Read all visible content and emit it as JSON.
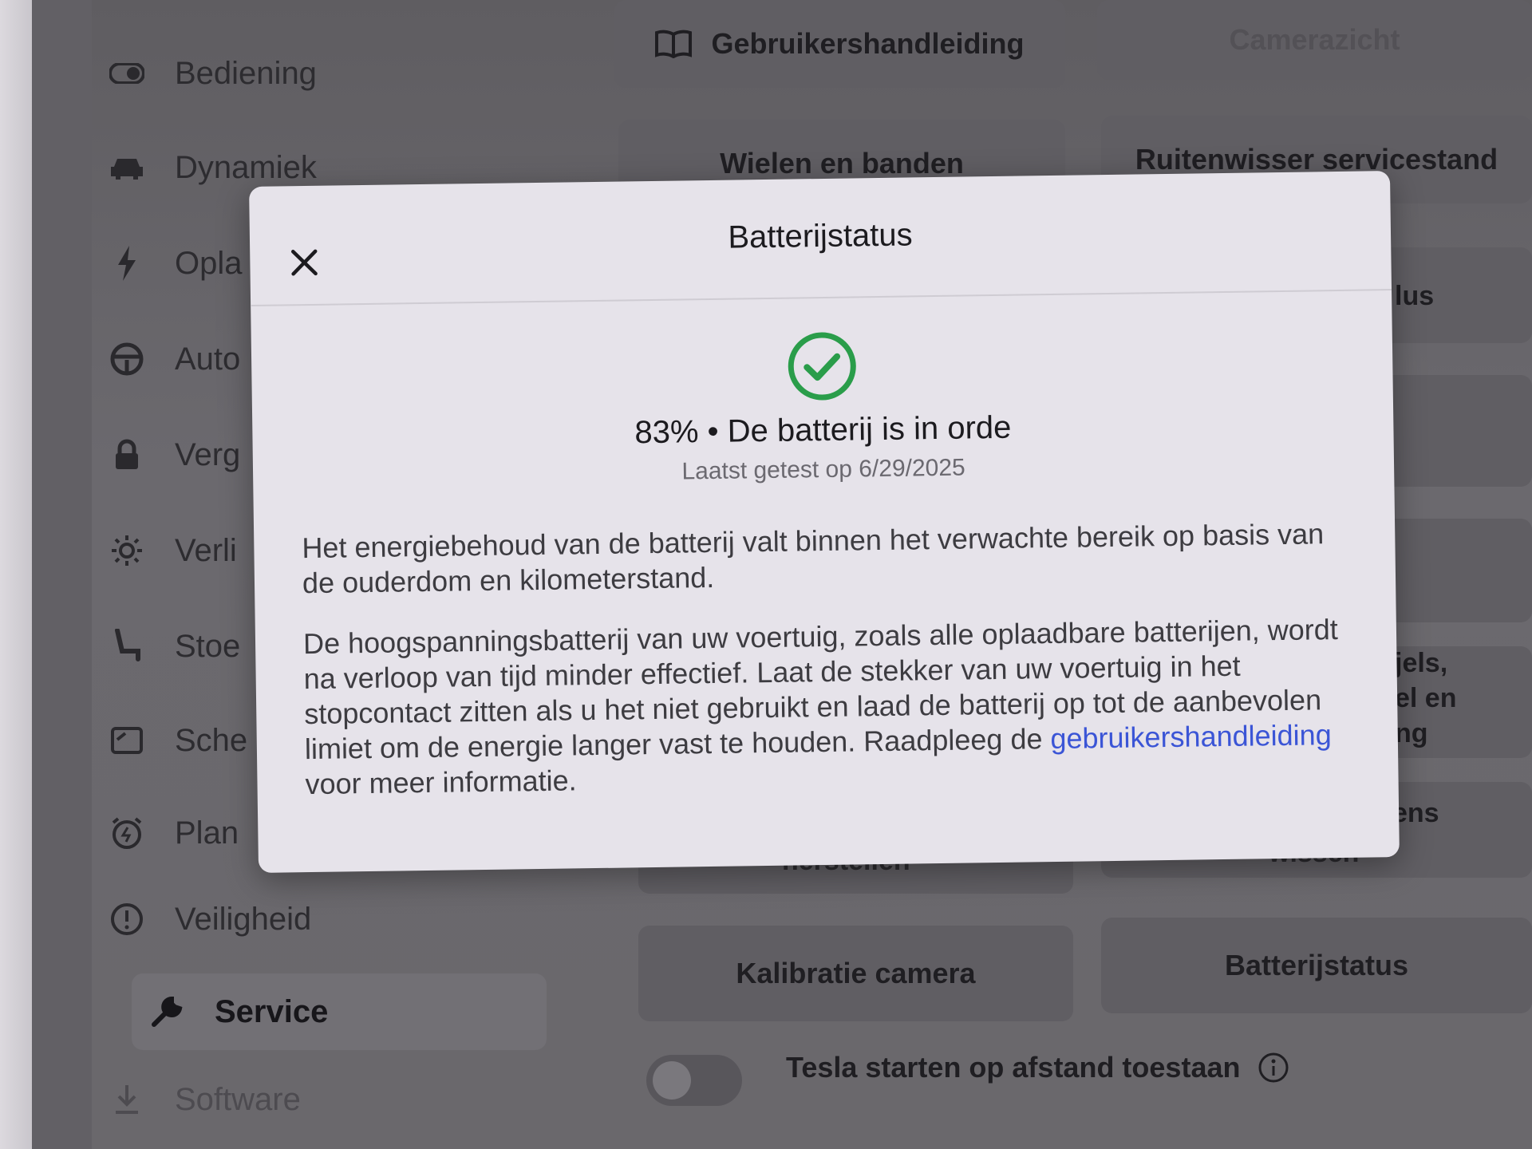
{
  "sidebar": {
    "items": [
      {
        "label": "Bediening",
        "icon": "toggle-icon"
      },
      {
        "label": "Dynamiek",
        "icon": "car-icon"
      },
      {
        "label": "Opla",
        "icon": "lightning-icon"
      },
      {
        "label": "Auto",
        "icon": "steering-wheel-icon"
      },
      {
        "label": "Verg",
        "icon": "lock-icon"
      },
      {
        "label": "Verli",
        "icon": "sun-icon"
      },
      {
        "label": "Stoe",
        "icon": "seat-icon"
      },
      {
        "label": "Sche",
        "icon": "screen-icon"
      },
      {
        "label": "Plan",
        "icon": "alarm-icon"
      },
      {
        "label": "Veiligheid",
        "icon": "alert-circle-icon"
      },
      {
        "label": "Service",
        "icon": "wrench-icon"
      },
      {
        "label": "Software",
        "icon": "download-icon"
      }
    ],
    "selected": "Service"
  },
  "tiles": {
    "manual": "Gebruikershandleiding",
    "camera_view": "Camerazicht",
    "wheels": "Wielen en banden",
    "wiper": "Ruitenwisser servicestand",
    "partial_lus": "lus",
    "partial_els": "jels,",
    "partial_elen": "el en",
    "partial_ng": "ng",
    "partial_ens": "ens",
    "partial_herstellen": "herstellen",
    "partial_wissen": "wissen",
    "calibration": "Kalibratie camera",
    "battery_status": "Batterijstatus"
  },
  "remote_start": {
    "label": "Tesla starten op afstand toestaan",
    "enabled": false
  },
  "modal": {
    "title": "Batterijstatus",
    "status_line": "83% • De batterij is in orde",
    "tested": "Laatst getest op 6/29/2025",
    "paragraph1": "Het energiebehoud van de batterij valt binnen het verwachte bereik op basis van de ouderdom en kilometerstand.",
    "paragraph2_text": "De hoogspanningsbatterij van uw voertuig, zoals alle oplaadbare batterijen, wordt na verloop van tijd minder effectief. Laat de stekker van uw voertuig in het stopcontact zitten als u het niet gebruikt en laad de batterij op tot de aanbevolen limiet om de energie langer vast te houden. Raadpleeg de",
    "link_text": "gebruikershandleiding",
    "paragraph2_tail": "voor meer informatie.",
    "check_color": "#2a9d4a",
    "link_color": "#3b55d6"
  }
}
